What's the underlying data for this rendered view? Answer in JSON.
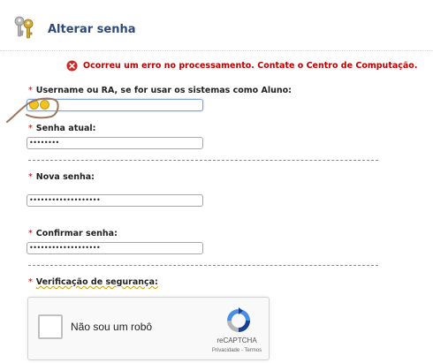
{
  "header": {
    "title": "Alterar senha",
    "icon": "keys-icon"
  },
  "error": {
    "icon": "error-icon",
    "text": "Ocorreu um erro no processamento. Contate o Centro de Computação.",
    "color": "#c00000"
  },
  "form": {
    "required_mark": "*",
    "username": {
      "label": "Username ou RA, se for usar os sistemas como Aluno:",
      "value": ""
    },
    "current_password": {
      "label": "Senha atual:",
      "value": "••••••••"
    },
    "new_password": {
      "label": "Nova senha:",
      "value": "•••••••••••••••••••"
    },
    "confirm_password": {
      "label": "Confirmar senha:",
      "value": "•••••••••••••••••••"
    },
    "security_check": {
      "label": "Verificação de segurança:"
    }
  },
  "captcha": {
    "checkbox_label": "Não sou um robô",
    "brand": "reCAPTCHA",
    "links": "Privacidade - Termos",
    "icon": "recaptcha-logo-icon"
  },
  "colors": {
    "title": "#2e4a78",
    "accent_input_focus": "#7fa3d8"
  }
}
